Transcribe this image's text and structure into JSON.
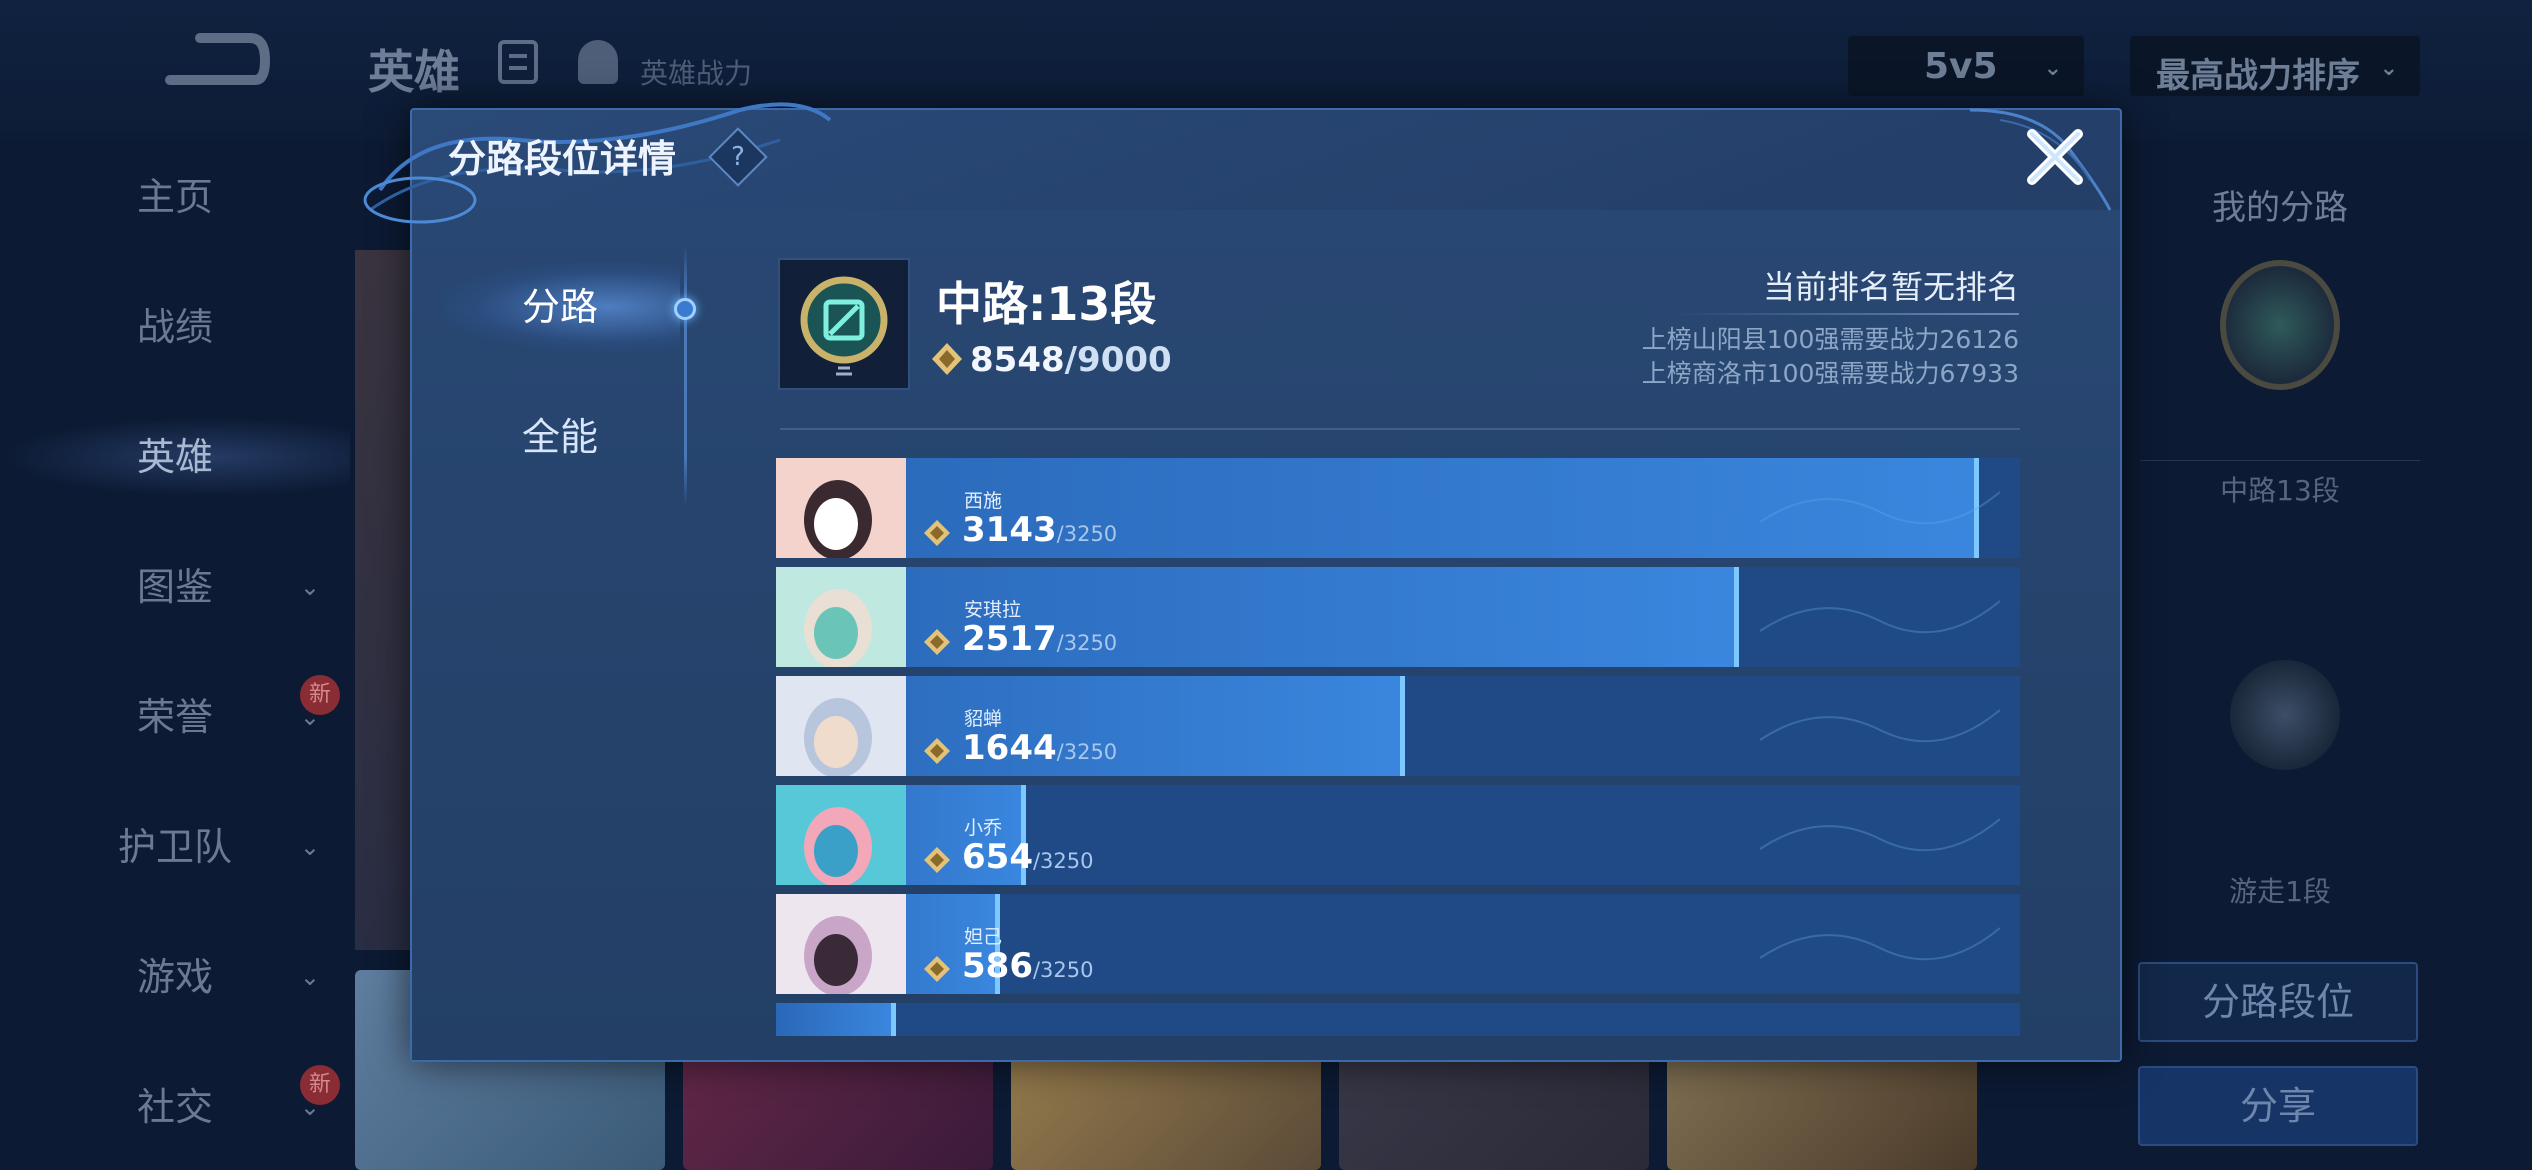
{
  "background": {
    "page_title": "英雄",
    "power_link": "英雄战力",
    "mode_select": "5v5",
    "sort_select": "最高战力排序",
    "sidebar": [
      {
        "label": "主页",
        "arrow": false,
        "badge": ""
      },
      {
        "label": "战绩",
        "arrow": false,
        "badge": ""
      },
      {
        "label": "英雄",
        "arrow": false,
        "badge": "",
        "active": true
      },
      {
        "label": "图鉴",
        "arrow": true,
        "badge": ""
      },
      {
        "label": "荣誉",
        "arrow": true,
        "badge": "新"
      },
      {
        "label": "护卫队",
        "arrow": true,
        "badge": ""
      },
      {
        "label": "游戏",
        "arrow": true,
        "badge": ""
      },
      {
        "label": "社交",
        "arrow": true,
        "badge": "新"
      }
    ],
    "right_panel": {
      "title": "我的分路",
      "lane_1": "中路13段",
      "lane_2": "游走1段",
      "lane_button": "分路段位",
      "share_button": "分享"
    }
  },
  "modal": {
    "title": "分路段位详情",
    "help": "?",
    "tabs": [
      {
        "label": "分路",
        "active": true
      },
      {
        "label": "全能",
        "active": false
      }
    ],
    "lane": {
      "name": "中路:13段",
      "score": "8548",
      "score_max": "/9000",
      "rank_title": "当前排名暂无排名",
      "requirements": [
        "上榜山阳县100强需要战力26126",
        "上榜商洛市100强需要战力67933"
      ]
    },
    "max_value": 3250,
    "heroes": [
      {
        "name": "西施",
        "score": 3143,
        "cap": "/3250",
        "colors": [
          "#f3d3cc",
          "#3a2a30",
          "#ffffff"
        ]
      },
      {
        "name": "安琪拉",
        "score": 2517,
        "cap": "/3250",
        "colors": [
          "#bfe8e0",
          "#e9dfd4",
          "#6ac4b8"
        ]
      },
      {
        "name": "貂蝉",
        "score": 1644,
        "cap": "/3250",
        "colors": [
          "#dfe6f2",
          "#b7c6dc",
          "#f0dccc"
        ]
      },
      {
        "name": "小乔",
        "score": 654,
        "cap": "/3250",
        "colors": [
          "#56c8d8",
          "#f2a8b8",
          "#3aa0c8"
        ]
      },
      {
        "name": "妲己",
        "score": 586,
        "cap": "/3250",
        "colors": [
          "#eee6ee",
          "#c9a6c8",
          "#3a2a38"
        ]
      }
    ]
  }
}
